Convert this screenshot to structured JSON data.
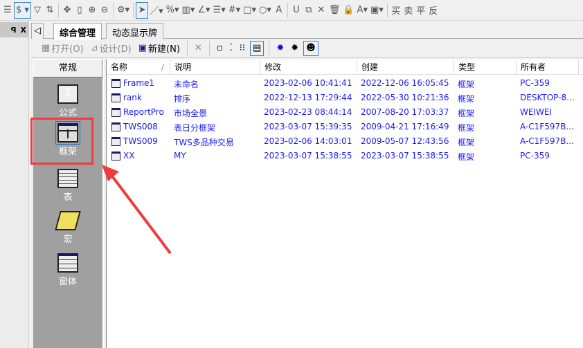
{
  "toolbar": {
    "items": [
      "doc-icon",
      "dollar-icon",
      "filter-icon",
      "sort-icon",
      "move-icon",
      "ruler-icon",
      "zoom-in-icon",
      "zoom-out-icon",
      "gear-icon",
      "pointer-icon",
      "line-icon",
      "percent-icon",
      "bars-icon",
      "angle-icon",
      "list-icon",
      "grid-icon",
      "rect-icon",
      "circle-icon",
      "A",
      "magnet-icon",
      "copy-icon",
      "X",
      "trash-icon",
      "lock-icon",
      "A",
      "save-icon"
    ],
    "trade": [
      "买",
      "卖",
      "平",
      "反"
    ]
  },
  "dock": {
    "pin": "ꟼ",
    "close": "X"
  },
  "tabs": [
    {
      "label": "综合管理",
      "active": true
    },
    {
      "label": "动态显示牌",
      "active": false
    }
  ],
  "subtoolbar": {
    "open": "打开(O)",
    "design": "设计(D)",
    "new": "新建(N)"
  },
  "nav": {
    "header": "常规",
    "items": [
      {
        "label": "公式",
        "icon": "formula-icon"
      },
      {
        "label": "框架",
        "icon": "frame-icon",
        "selected": true
      },
      {
        "label": "表",
        "icon": "table-icon"
      },
      {
        "label": "宏",
        "icon": "macro-icon"
      },
      {
        "label": "窗体",
        "icon": "form-icon"
      }
    ]
  },
  "list": {
    "columns": [
      "名称",
      "说明",
      "修改",
      "创建",
      "类型",
      "所有者"
    ],
    "rows": [
      [
        "Frame1",
        "未命名",
        "2023-02-06 10:41:41",
        "2022-12-06 16:05:45",
        "框架",
        "PC-359"
      ],
      [
        "rank",
        "排序",
        "2022-12-13 17:29:44",
        "2022-05-30 10:21:36",
        "框架",
        "DESKTOP-8..."
      ],
      [
        "ReportPro",
        "市场全景",
        "2023-02-23 08:44:14",
        "2007-08-20 17:03:37",
        "框架",
        "WEIWEI"
      ],
      [
        "TWS008",
        "表日分框架",
        "2023-03-07 15:39:35",
        "2009-04-21 17:16:49",
        "框架",
        "A-C1F597B..."
      ],
      [
        "TWS009",
        "TWS多品种交易",
        "2023-02-06 14:03:01",
        "2009-05-07 12:43:56",
        "框架",
        "A-C1F597B..."
      ],
      [
        "XX",
        "MY",
        "2023-03-07 15:38:55",
        "2023-03-07 15:38:55",
        "框架",
        "PC-359"
      ]
    ]
  },
  "colors": {
    "highlight": "#f03c3c",
    "link": "#1a1aff",
    "nav": "#a0a0a0"
  }
}
